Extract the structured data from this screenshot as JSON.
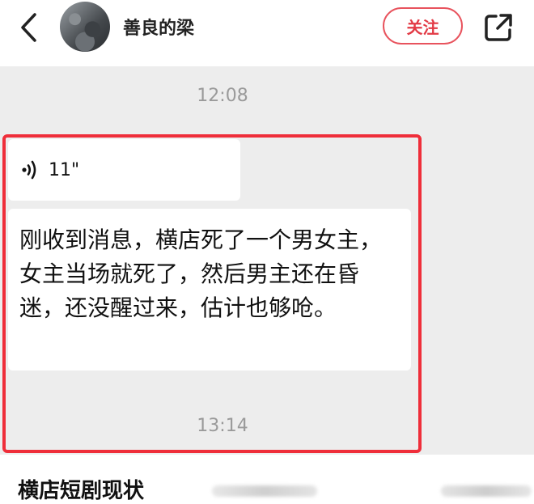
{
  "header": {
    "username": "善良的梁",
    "follow_label": "关注",
    "icons": {
      "back": "back-arrow-icon",
      "share": "share-external-icon"
    }
  },
  "chat": {
    "time_1": "12:08",
    "voice_duration": "11\"",
    "message_text": "刚收到消息，横店死了一个男女主，女主当场就死了，然后男主还在昏迷，还没醒过来，估计也够呛。",
    "time_2": "13:14",
    "highlight_color": "#ef2e3a"
  },
  "footer": {
    "title": "横店短剧现状"
  },
  "colors": {
    "accent": "#e23a45",
    "chat_bg": "#ededed"
  }
}
